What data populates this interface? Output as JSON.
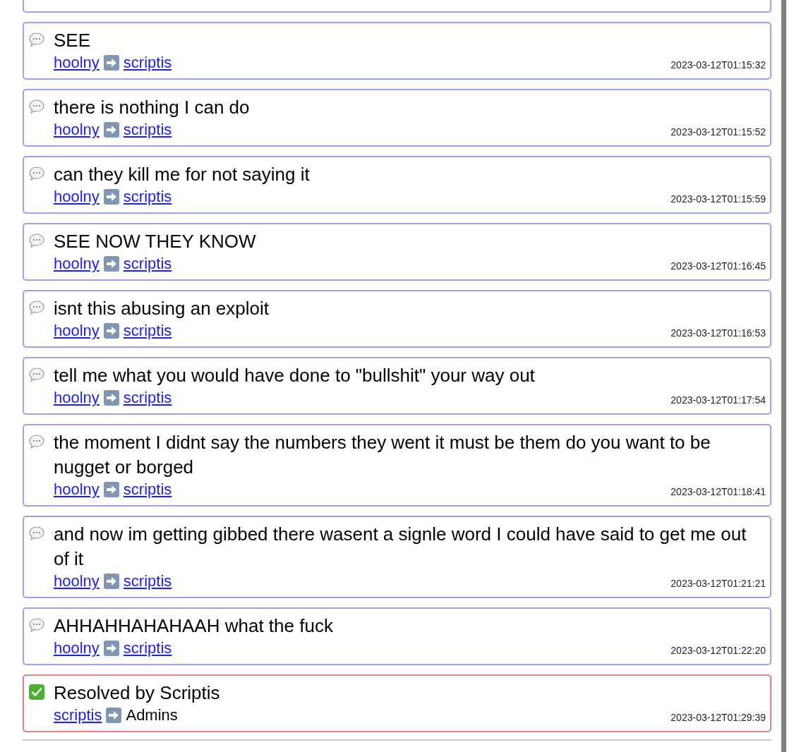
{
  "entries": [
    {
      "kind": "message",
      "text": "SEE",
      "sender": "hoolny",
      "recipient": "scriptis",
      "recipient_link": true,
      "time": "2023-03-12T01:15:32"
    },
    {
      "kind": "message",
      "text": "there is nothing I can do",
      "sender": "hoolny",
      "recipient": "scriptis",
      "recipient_link": true,
      "time": "2023-03-12T01:15:52"
    },
    {
      "kind": "message",
      "text": "can they kill me for not saying it",
      "sender": "hoolny",
      "recipient": "scriptis",
      "recipient_link": true,
      "time": "2023-03-12T01:15:59"
    },
    {
      "kind": "message",
      "text": "SEE NOW THEY KNOW",
      "sender": "hoolny",
      "recipient": "scriptis",
      "recipient_link": true,
      "time": "2023-03-12T01:16:45"
    },
    {
      "kind": "message",
      "text": "isnt this abusing an exploit",
      "sender": "hoolny",
      "recipient": "scriptis",
      "recipient_link": true,
      "time": "2023-03-12T01:16:53"
    },
    {
      "kind": "message",
      "text": "tell me what you would have done to \"bullshit\" your way out",
      "sender": "hoolny",
      "recipient": "scriptis",
      "recipient_link": true,
      "time": "2023-03-12T01:17:54"
    },
    {
      "kind": "message",
      "text": "the moment I didnt say the numbers they went it must be them do you want to be nugget or borged",
      "sender": "hoolny",
      "recipient": "scriptis",
      "recipient_link": true,
      "time": "2023-03-12T01:18:41"
    },
    {
      "kind": "message",
      "text": "and now im getting gibbed there wasent a signle word I could have said to get me out of it",
      "sender": "hoolny",
      "recipient": "scriptis",
      "recipient_link": true,
      "time": "2023-03-12T01:21:21"
    },
    {
      "kind": "message",
      "text": "AHHAHHAHAHAAH what the fuck",
      "sender": "hoolny",
      "recipient": "scriptis",
      "recipient_link": true,
      "time": "2023-03-12T01:22:20"
    },
    {
      "kind": "resolved",
      "text": "Resolved by Scriptis",
      "sender": "scriptis",
      "recipient": "Admins",
      "recipient_link": false,
      "time": "2023-03-12T01:29:39"
    }
  ]
}
